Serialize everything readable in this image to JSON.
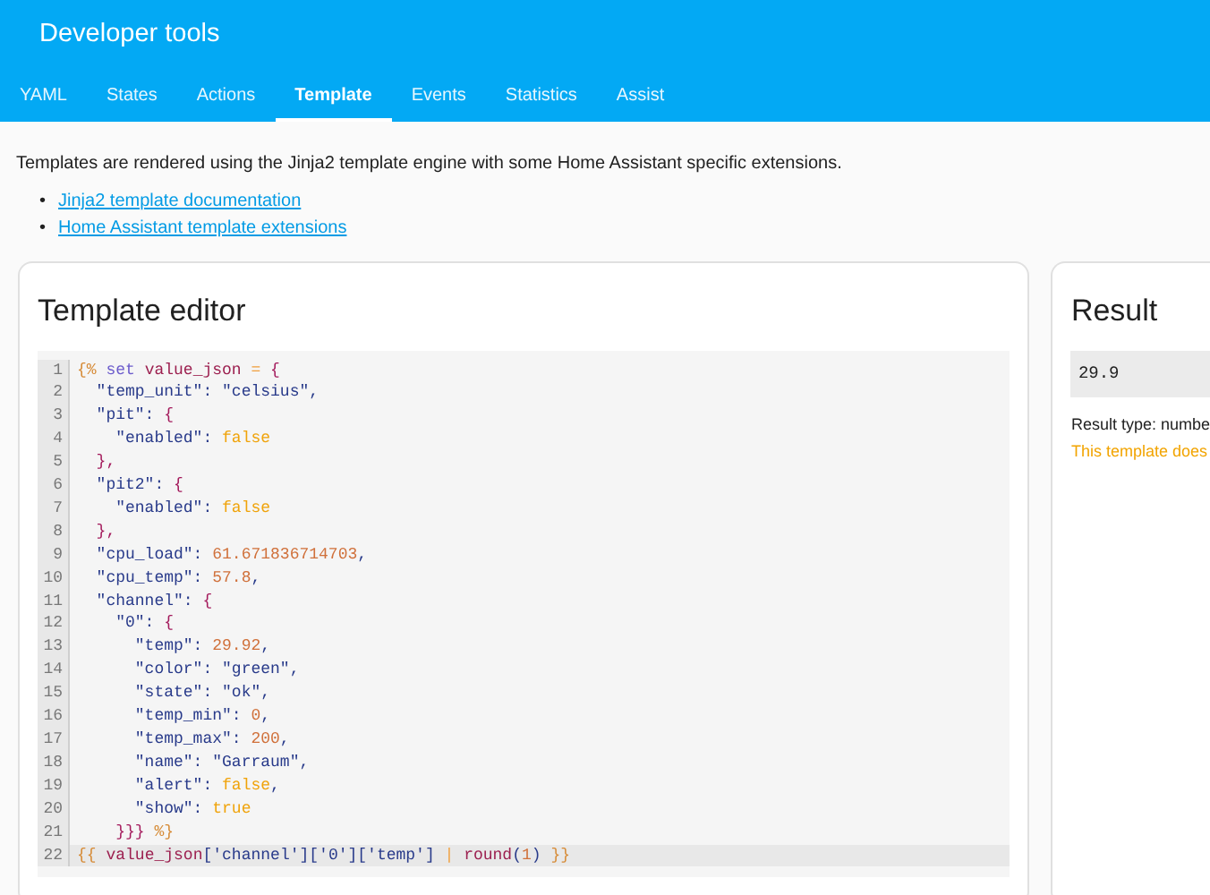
{
  "header": {
    "title": "Developer tools"
  },
  "tabs": [
    {
      "label": "YAML",
      "selected": false
    },
    {
      "label": "States",
      "selected": false
    },
    {
      "label": "Actions",
      "selected": false
    },
    {
      "label": "Template",
      "selected": true
    },
    {
      "label": "Events",
      "selected": false
    },
    {
      "label": "Statistics",
      "selected": false
    },
    {
      "label": "Assist",
      "selected": false
    }
  ],
  "intro": "Templates are rendered using the Jinja2 template engine with some Home Assistant specific extensions.",
  "links": [
    {
      "marker": "•",
      "text": "Jinja2 template documentation"
    },
    {
      "marker": "•",
      "text": "Home Assistant template extensions"
    }
  ],
  "editor": {
    "title": "Template editor",
    "lines": [
      {
        "number": "1",
        "active": false,
        "tokens": [
          {
            "kind": "delim",
            "text": "{%"
          },
          {
            "kind": "keyword",
            "text": " set"
          },
          {
            "kind": "variable",
            "text": " value_json"
          },
          {
            "kind": "op",
            "text": " ="
          },
          {
            "kind": "brace",
            "text": " {"
          }
        ]
      },
      {
        "number": "2",
        "active": false,
        "tokens": [
          {
            "kind": "string",
            "text": "  \"temp_unit\": \"celsius\","
          }
        ]
      },
      {
        "number": "3",
        "active": false,
        "tokens": [
          {
            "kind": "string",
            "text": "  \"pit\": "
          },
          {
            "kind": "brace",
            "text": "{"
          }
        ]
      },
      {
        "number": "4",
        "active": false,
        "tokens": [
          {
            "kind": "string",
            "text": "    \"enabled\": "
          },
          {
            "kind": "bool",
            "text": "false"
          }
        ]
      },
      {
        "number": "5",
        "active": false,
        "tokens": [
          {
            "kind": "brace",
            "text": "  },"
          }
        ]
      },
      {
        "number": "6",
        "active": false,
        "tokens": [
          {
            "kind": "string",
            "text": "  \"pit2\": "
          },
          {
            "kind": "brace",
            "text": "{"
          }
        ]
      },
      {
        "number": "7",
        "active": false,
        "tokens": [
          {
            "kind": "string",
            "text": "    \"enabled\": "
          },
          {
            "kind": "bool",
            "text": "false"
          }
        ]
      },
      {
        "number": "8",
        "active": false,
        "tokens": [
          {
            "kind": "brace",
            "text": "  },"
          }
        ]
      },
      {
        "number": "9",
        "active": false,
        "tokens": [
          {
            "kind": "string",
            "text": "  \"cpu_load\": "
          },
          {
            "kind": "number",
            "text": "61.671836714703"
          },
          {
            "kind": "string",
            "text": ","
          }
        ]
      },
      {
        "number": "10",
        "active": false,
        "tokens": [
          {
            "kind": "string",
            "text": "  \"cpu_temp\": "
          },
          {
            "kind": "number",
            "text": "57.8"
          },
          {
            "kind": "string",
            "text": ","
          }
        ]
      },
      {
        "number": "11",
        "active": false,
        "tokens": [
          {
            "kind": "string",
            "text": "  \"channel\": "
          },
          {
            "kind": "brace",
            "text": "{"
          }
        ]
      },
      {
        "number": "12",
        "active": false,
        "tokens": [
          {
            "kind": "string",
            "text": "    \"0\": "
          },
          {
            "kind": "brace",
            "text": "{"
          }
        ]
      },
      {
        "number": "13",
        "active": false,
        "tokens": [
          {
            "kind": "string",
            "text": "      \"temp\": "
          },
          {
            "kind": "number",
            "text": "29.92"
          },
          {
            "kind": "string",
            "text": ","
          }
        ]
      },
      {
        "number": "14",
        "active": false,
        "tokens": [
          {
            "kind": "string",
            "text": "      \"color\": \"green\","
          }
        ]
      },
      {
        "number": "15",
        "active": false,
        "tokens": [
          {
            "kind": "string",
            "text": "      \"state\": \"ok\","
          }
        ]
      },
      {
        "number": "16",
        "active": false,
        "tokens": [
          {
            "kind": "string",
            "text": "      \"temp_min\": "
          },
          {
            "kind": "number",
            "text": "0"
          },
          {
            "kind": "string",
            "text": ","
          }
        ]
      },
      {
        "number": "17",
        "active": false,
        "tokens": [
          {
            "kind": "string",
            "text": "      \"temp_max\": "
          },
          {
            "kind": "number",
            "text": "200"
          },
          {
            "kind": "string",
            "text": ","
          }
        ]
      },
      {
        "number": "18",
        "active": false,
        "tokens": [
          {
            "kind": "string",
            "text": "      \"name\": \"Garraum\","
          }
        ]
      },
      {
        "number": "19",
        "active": false,
        "tokens": [
          {
            "kind": "string",
            "text": "      \"alert\": "
          },
          {
            "kind": "bool",
            "text": "false"
          },
          {
            "kind": "string",
            "text": ","
          }
        ]
      },
      {
        "number": "20",
        "active": false,
        "tokens": [
          {
            "kind": "string",
            "text": "      \"show\": "
          },
          {
            "kind": "bool",
            "text": "true"
          }
        ]
      },
      {
        "number": "21",
        "active": false,
        "tokens": [
          {
            "kind": "brace",
            "text": "    }}}"
          },
          {
            "kind": "delim",
            "text": " %}"
          }
        ]
      },
      {
        "number": "22",
        "active": true,
        "tokens": [
          {
            "kind": "delim",
            "text": "{{"
          },
          {
            "kind": "variable",
            "text": " value_json"
          },
          {
            "kind": "string",
            "text": "['channel']['0']['temp']"
          },
          {
            "kind": "op",
            "text": " |"
          },
          {
            "kind": "variable",
            "text": " round"
          },
          {
            "kind": "string",
            "text": "("
          },
          {
            "kind": "number",
            "text": "1"
          },
          {
            "kind": "string",
            "text": ")"
          },
          {
            "kind": "delim",
            "text": " }}"
          }
        ]
      }
    ]
  },
  "result": {
    "title": "Result",
    "value": "29.9",
    "type_text": "Result type: numbe",
    "warning": "This template does"
  }
}
